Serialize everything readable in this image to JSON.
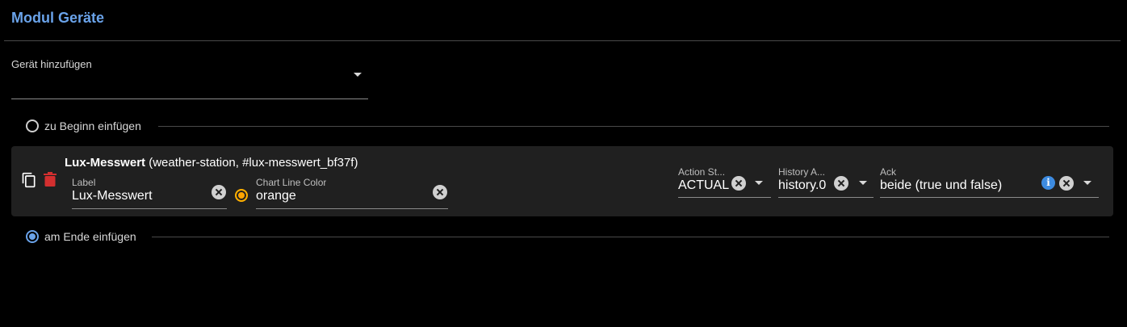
{
  "header": {
    "title": "Modul Geräte"
  },
  "add_device": {
    "label": "Gerät hinzufügen",
    "value": ""
  },
  "insert_start": {
    "label": "zu Beginn einfügen",
    "checked": false
  },
  "insert_end": {
    "label": "am Ende einfügen",
    "checked": true
  },
  "device": {
    "name": "Lux-Messwert",
    "meta": " (weather-station, #lux-messwert_bf37f)",
    "fields": {
      "label": {
        "label": "Label",
        "value": "Lux-Messwert"
      },
      "chart_line_color": {
        "label": "Chart Line Color",
        "value": "orange",
        "swatch": "#ffa500"
      },
      "action_state": {
        "label": "Action St...",
        "value": "ACTUAL"
      },
      "history_adapter": {
        "label": "History A...",
        "value": "history.0"
      },
      "ack": {
        "label": "Ack",
        "value": "beide (true und false)"
      }
    }
  },
  "icons": [
    "copy-icon",
    "delete-icon",
    "clear-icon",
    "chevron-down-icon",
    "info-icon"
  ],
  "colors": {
    "accent": "#6aa3ea",
    "delete": "#d32f2f",
    "card_bg": "#202020",
    "info": "#3d8be0"
  }
}
